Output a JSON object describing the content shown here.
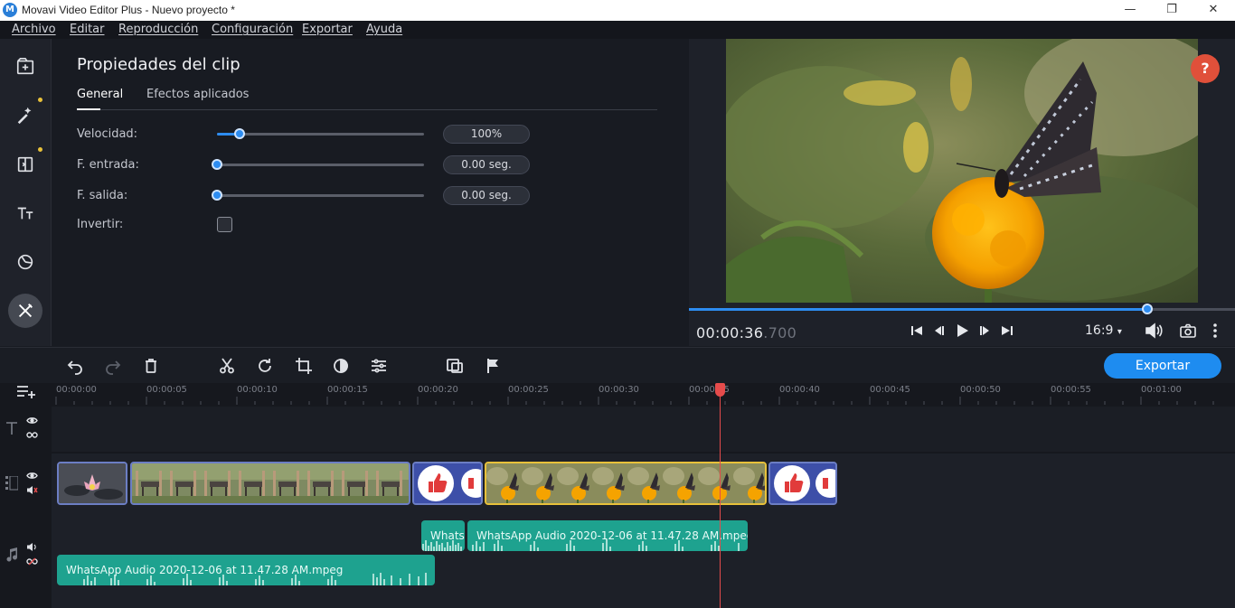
{
  "window": {
    "title": "Movavi Video Editor Plus - Nuevo proyecto *",
    "minimize": "—",
    "maximize": "❐",
    "close": "✕"
  },
  "menu": [
    "Archivo",
    "Editar",
    "Reproducción",
    "Configuración",
    "Exportar",
    "Ayuda"
  ],
  "sidebar": [
    {
      "icon": "import-icon"
    },
    {
      "icon": "magic-wand-icon"
    },
    {
      "icon": "transitions-icon"
    },
    {
      "icon": "titles-icon"
    },
    {
      "icon": "stickers-icon"
    },
    {
      "icon": "more-tools-icon"
    }
  ],
  "properties": {
    "title": "Propiedades del clip",
    "tabs": [
      "General",
      "Efectos aplicados"
    ],
    "active_tab": "General",
    "speed": {
      "label": "Velocidad:",
      "value": "100%",
      "level": 0.11
    },
    "fade_in": {
      "label": "F. entrada:",
      "value": "0.00 seg.",
      "level": 0
    },
    "fade_out": {
      "label": "F. salida:",
      "value": "0.00 seg.",
      "level": 0
    },
    "reverse": {
      "label": "Invertir:",
      "checked": false
    }
  },
  "preview": {
    "help": "?",
    "timecode_main": "00:00:36",
    "timecode_ms": ".700",
    "aspect_ratio": "16:9",
    "progress": 0.84
  },
  "toolbar": {
    "export": "Exportar",
    "tools": [
      "undo-icon",
      "redo-icon",
      "delete-icon",
      "cut-icon",
      "rotate-icon",
      "crop-icon",
      "color-adjust-icon",
      "clip-properties-icon",
      "split-screen-icon",
      "marker-icon"
    ]
  },
  "timeline": {
    "ruler": [
      "00:00:00",
      "00:00:05",
      "00:00:10",
      "00:00:15",
      "00:00:20",
      "00:00:25",
      "00:00:30",
      "00:00:35",
      "00:00:40",
      "00:00:45",
      "00:00:50",
      "00:00:55",
      "00:01:00"
    ],
    "audio_clips": [
      {
        "label": "Whats"
      },
      {
        "label": "WhatsApp Audio 2020-12-06 at 11.47.28 AM.mpeg"
      },
      {
        "label": "WhatsApp Audio 2020-12-06 at 11.47.28 AM.mpeg"
      }
    ],
    "playhead_time": "00:00:36.700"
  },
  "colors": {
    "accent": "#1e8cf0",
    "playhead": "#e54b4b",
    "audio_clip": "#1ea28f",
    "selected_clip_border": "#e8c13a"
  }
}
